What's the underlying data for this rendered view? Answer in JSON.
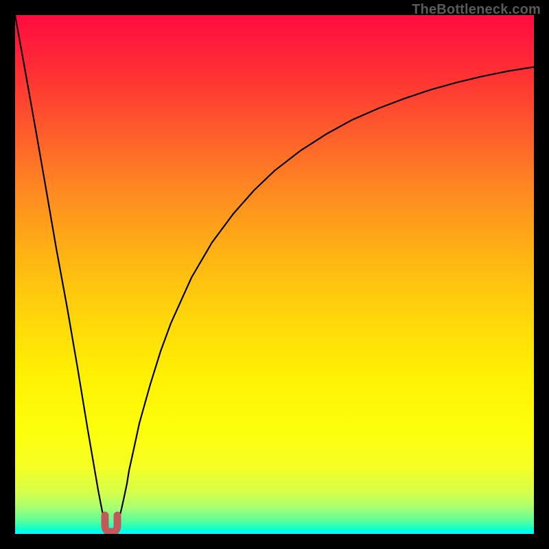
{
  "watermark": {
    "text": "TheBottleneck.com"
  },
  "colors": {
    "frame": "#000000",
    "curve": "#000000",
    "marker": "#c15a5a"
  },
  "chart_data": {
    "type": "line",
    "title": "",
    "xlabel": "",
    "ylabel": "",
    "xlim": [
      0,
      100
    ],
    "ylim": [
      0,
      100
    ],
    "grid": false,
    "legend": false,
    "annotations": [
      "TheBottleneck.com"
    ],
    "series": [
      {
        "name": "bottleneck-curve",
        "x": [
          0,
          2,
          4,
          6,
          8,
          10,
          12,
          14,
          16,
          16.5,
          17,
          17.5,
          18,
          18.5,
          19,
          19.5,
          20,
          20.5,
          21,
          21.5,
          22,
          23,
          24,
          26,
          28,
          30,
          34,
          38,
          42,
          46,
          50,
          55,
          60,
          65,
          70,
          75,
          80,
          85,
          90,
          95,
          100
        ],
        "y": [
          100,
          89,
          78,
          66.5,
          55,
          43.5,
          32,
          20,
          8.5,
          5.7,
          3.1,
          1.2,
          0.2,
          0.0,
          0.2,
          1.1,
          2.7,
          4.8,
          7.2,
          9.7,
          12.2,
          17.0,
          21.3,
          28.8,
          35.2,
          40.6,
          49.4,
          56.2,
          61.7,
          66.2,
          70.0,
          73.9,
          77.1,
          79.8,
          82.0,
          83.9,
          85.6,
          87.0,
          88.2,
          89.2,
          90.0
        ]
      }
    ],
    "markers": [
      {
        "name": "trough-marker",
        "shape": "U",
        "x": 18.5,
        "y": 0,
        "width_pct": 2.2,
        "height_pct": 3.8,
        "color": "#c15a5a"
      }
    ]
  }
}
